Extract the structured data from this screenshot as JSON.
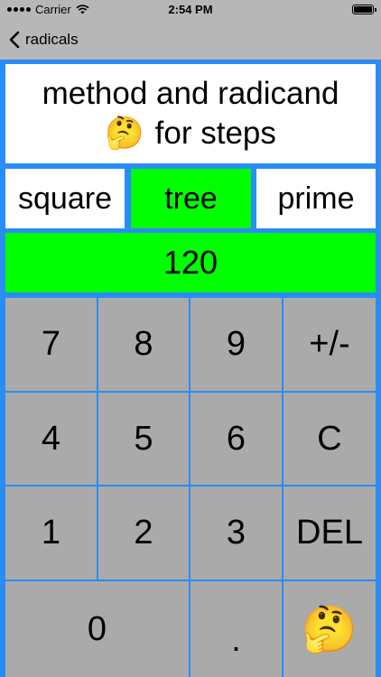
{
  "status_bar": {
    "carrier": "Carrier",
    "time": "2:54 PM"
  },
  "nav": {
    "back_label": "radicals"
  },
  "header": {
    "line1": "method and radicand",
    "line2": "for steps",
    "emoji": "🤔"
  },
  "methods": [
    {
      "label": "square",
      "selected": false
    },
    {
      "label": "tree",
      "selected": true
    },
    {
      "label": "prime",
      "selected": false
    }
  ],
  "display": {
    "value": "120"
  },
  "keypad": {
    "k7": "7",
    "k8": "8",
    "k9": "9",
    "plusminus": "+/-",
    "k4": "4",
    "k5": "5",
    "k6": "6",
    "clear": "C",
    "k1": "1",
    "k2": "2",
    "k3": "3",
    "del": "DEL",
    "k0": "0",
    "dot": ".",
    "emoji": "🤔"
  },
  "colors": {
    "chrome_gray": "#b7b7b7",
    "border_blue": "#2a8cf7",
    "selected_green": "#00ff00",
    "key_gray": "#aaaaaa"
  }
}
